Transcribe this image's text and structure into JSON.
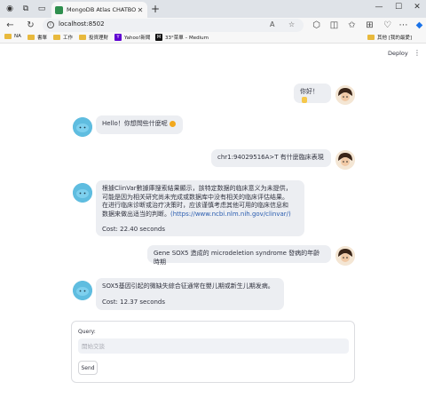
{
  "browser": {
    "tab_title": "MongoDB Atlas CHATBOT TEST",
    "tab_close": "✕",
    "new_tab": "+",
    "url": "localhost:8502",
    "window_controls": [
      "—",
      "☐",
      "✕"
    ],
    "bookmarks": [
      {
        "label": "NA",
        "icon": "folder-icon"
      },
      {
        "label": "書單",
        "icon": "folder-icon"
      },
      {
        "label": "工作",
        "icon": "folder-icon"
      },
      {
        "label": "投資理財",
        "icon": "folder-icon"
      },
      {
        "label": "Yahoo!新聞",
        "icon": "yahoo-icon"
      },
      {
        "label": "33°菜單 – Medium",
        "icon": "medium-icon"
      }
    ],
    "other_bookmarks": "其他 [我的最愛]"
  },
  "app": {
    "deploy_label": "Deploy",
    "menu_icon": "⋮"
  },
  "chat": {
    "messages": [
      {
        "role": "user",
        "text": "你好！"
      },
      {
        "role": "assistant",
        "text": "Hello！你想問些什麼呢"
      },
      {
        "role": "user",
        "text": "chr1:94029516A>T 有什麼臨床表現"
      },
      {
        "role": "assistant",
        "line1": "根據ClinVar數據庫搜索結果顯示，該特定数据的临床意义为未提供，",
        "line2": "可能是因为相关研究尚未完成或数据库中没有相关的临床评估结果。",
        "line3": "在进行临床诊断或治疗决策时，应该谨慎考虑其他可用的临床信息和",
        "line4": "数据来做出适当的判断。",
        "link": "(https://www.ncbi.nlm.nih.gov/clinvar/)",
        "cost": "Cost: 22.40 seconds"
      },
      {
        "role": "user",
        "text": "Gene SOX5 造成的 microdeletion syndrome 發病的年齡時期"
      },
      {
        "role": "assistant",
        "text": "SOX5基因引起的微缺失綜合征通常在嬰儿期或新生儿期发病。",
        "cost": "Cost: 12.37 seconds"
      }
    ]
  },
  "query": {
    "label": "Query:",
    "placeholder": "開始交談",
    "send_label": "Send"
  }
}
